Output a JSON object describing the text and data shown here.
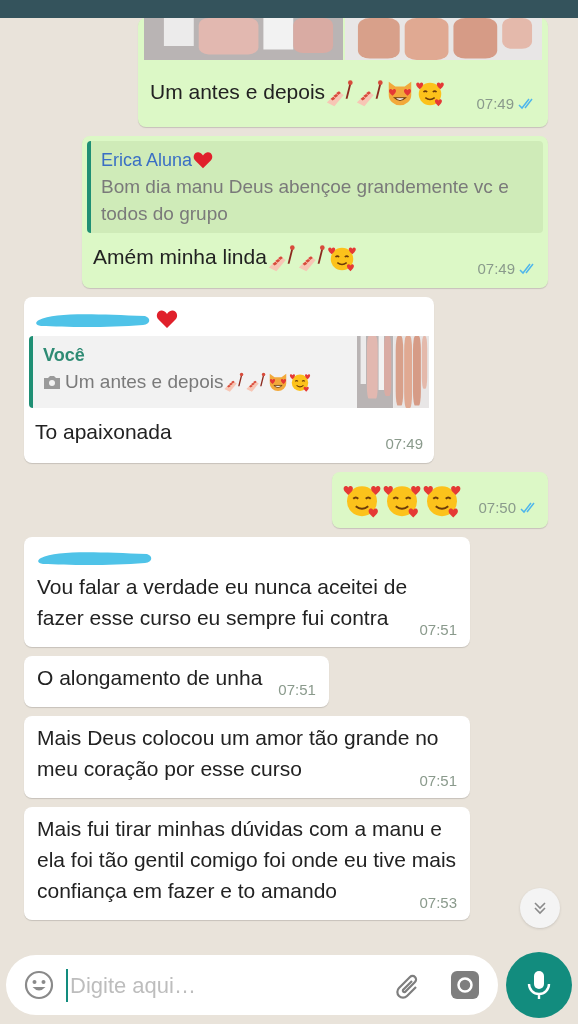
{
  "messages": [
    {
      "outgoing": true,
      "text": "Um antes e depois",
      "emojis": [
        {
          "kind": "nail-polish"
        },
        {
          "kind": "nail-polish"
        },
        {
          "kind": "heart-eyes-cat"
        },
        {
          "kind": "smiling-hearts"
        }
      ],
      "time": "07:49",
      "read": true
    },
    {
      "kind": "reply",
      "outgoing": true,
      "quote": {
        "author": "Erica Aluna",
        "author_emojis": [
          {
            "kind": "red-heart"
          }
        ],
        "text": "Bom dia manu Deus abençoe grandemente vc e todos do grupo"
      },
      "text": "Amém minha linda",
      "emojis": [
        {
          "kind": "nail-polish"
        },
        {
          "kind": "nail-polish"
        },
        {
          "kind": "smiling-hearts"
        }
      ],
      "time": "07:49",
      "read": true
    },
    {
      "kind": "reply",
      "outgoing": false,
      "sender_redacted": true,
      "sender_emojis": [
        {
          "kind": "red-heart"
        }
      ],
      "quote": {
        "author": "Você",
        "photo": true,
        "text": "Um antes e depois",
        "emojis": [
          {
            "kind": "nail-polish"
          },
          {
            "kind": "nail-polish"
          },
          {
            "kind": "heart-eyes-cat"
          },
          {
            "kind": "smiling-hearts"
          }
        ]
      },
      "text": "To apaixonada",
      "time": "07:49"
    },
    {
      "kind": "emoji",
      "outgoing": true,
      "emojis": [
        {
          "kind": "smiling-hearts"
        },
        {
          "kind": "smiling-hearts"
        },
        {
          "kind": "smiling-hearts"
        }
      ],
      "time": "07:50",
      "read": true
    },
    {
      "kind": "text",
      "outgoing": false,
      "sender_redacted": true,
      "text": "Vou falar a verdade eu nunca aceitei de fazer esse curso eu sempre fui contra",
      "time": "07:51"
    },
    {
      "kind": "text",
      "outgoing": false,
      "text": "O alongamento de unha",
      "time": "07:51"
    },
    {
      "kind": "text",
      "outgoing": false,
      "text": "Mais Deus colocou um amor tão grande no meu coração por esse curso",
      "time": "07:51"
    },
    {
      "kind": "text",
      "outgoing": false,
      "text": "Mais fui tirar minhas dúvidas com a manu e ela foi tão gentil comigo foi onde eu tive mais confiança em fazer e to amando",
      "time": "07:53"
    }
  ],
  "composer": {
    "placeholder": "Digite aqui…"
  }
}
